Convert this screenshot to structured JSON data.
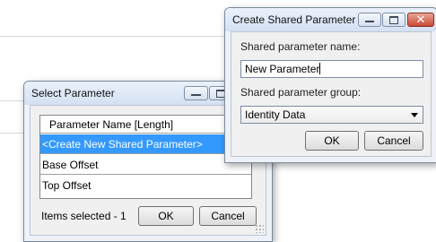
{
  "select_parameter": {
    "title": "Select Parameter",
    "list": {
      "header": "Parameter Name [Length]",
      "rows": [
        {
          "label": "<Create New Shared Parameter>",
          "selected": true
        },
        {
          "label": "Base Offset",
          "selected": false
        },
        {
          "label": "Top Offset",
          "selected": false
        }
      ]
    },
    "items_selected": "Items selected - 1",
    "ok_label": "OK",
    "cancel_label": "Cancel"
  },
  "create_shared_parameter": {
    "title": "Create Shared Parameter",
    "name_label": "Shared parameter name:",
    "name_value": "New Parameter",
    "group_label": "Shared parameter group:",
    "group_value": "Identity Data",
    "ok_label": "OK",
    "cancel_label": "Cancel"
  },
  "icons": {
    "minimize": "minimize-icon",
    "maximize": "maximize-icon",
    "close": "close-icon",
    "dropdown": "chevron-down-icon"
  },
  "colors": {
    "selection": "#3399ff",
    "close_button": "#c94a33",
    "titlebar": "#d4e1f3"
  }
}
